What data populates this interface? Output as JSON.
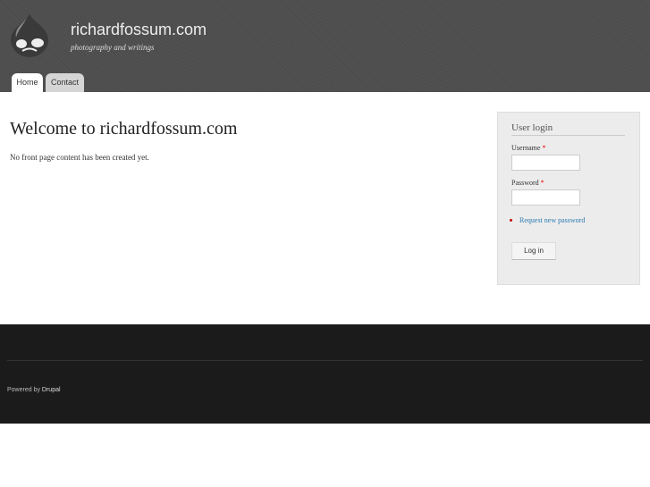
{
  "header": {
    "site_name": "richardfossum.com",
    "slogan": "photography and writings",
    "tabs": [
      {
        "label": "Home"
      },
      {
        "label": "Contact"
      }
    ]
  },
  "main": {
    "title": "Welcome to richardfossum.com",
    "message": "No front page content has been created yet."
  },
  "login": {
    "title": "User login",
    "username_label": "Username",
    "password_label": "Password",
    "required": "*",
    "request_password": "Request new password",
    "login_button": "Log in"
  },
  "footer": {
    "powered_by": "Powered by",
    "drupal": "Drupal"
  }
}
